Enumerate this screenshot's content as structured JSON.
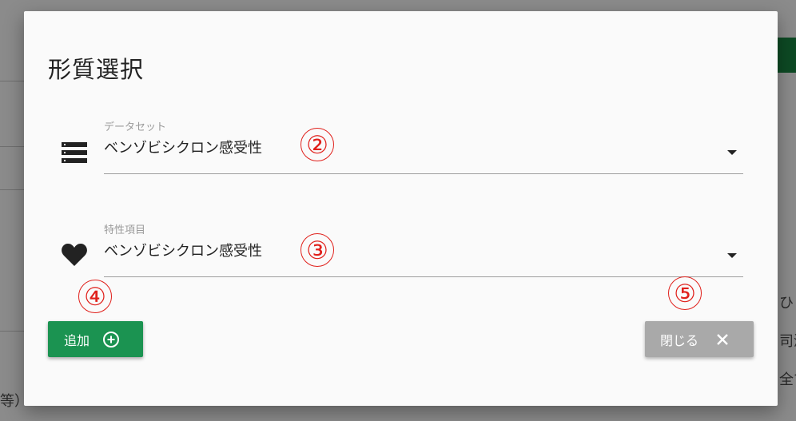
{
  "background": {
    "right_fragments": [
      "ひと",
      "司済",
      "全て"
    ],
    "left_fragment": "等）"
  },
  "dialog": {
    "title": "形質選択",
    "dataset_field": {
      "label": "データセット",
      "value": "ベンゾビシクロン感受性",
      "icon": "dataset-icon"
    },
    "trait_field": {
      "label": "特性項目",
      "value": "ベンゾビシクロン感受性",
      "icon": "heart-icon"
    },
    "add_button": {
      "label": "追加",
      "icon": "plus-circle-icon"
    },
    "close_button": {
      "label": "閉じる",
      "icon": "close-icon"
    },
    "annotations": [
      "②",
      "③",
      "④",
      "⑤"
    ],
    "colors": {
      "add_button": "#1b9351",
      "close_button": "#a9a9a9",
      "annotation": "#e0201b"
    }
  }
}
